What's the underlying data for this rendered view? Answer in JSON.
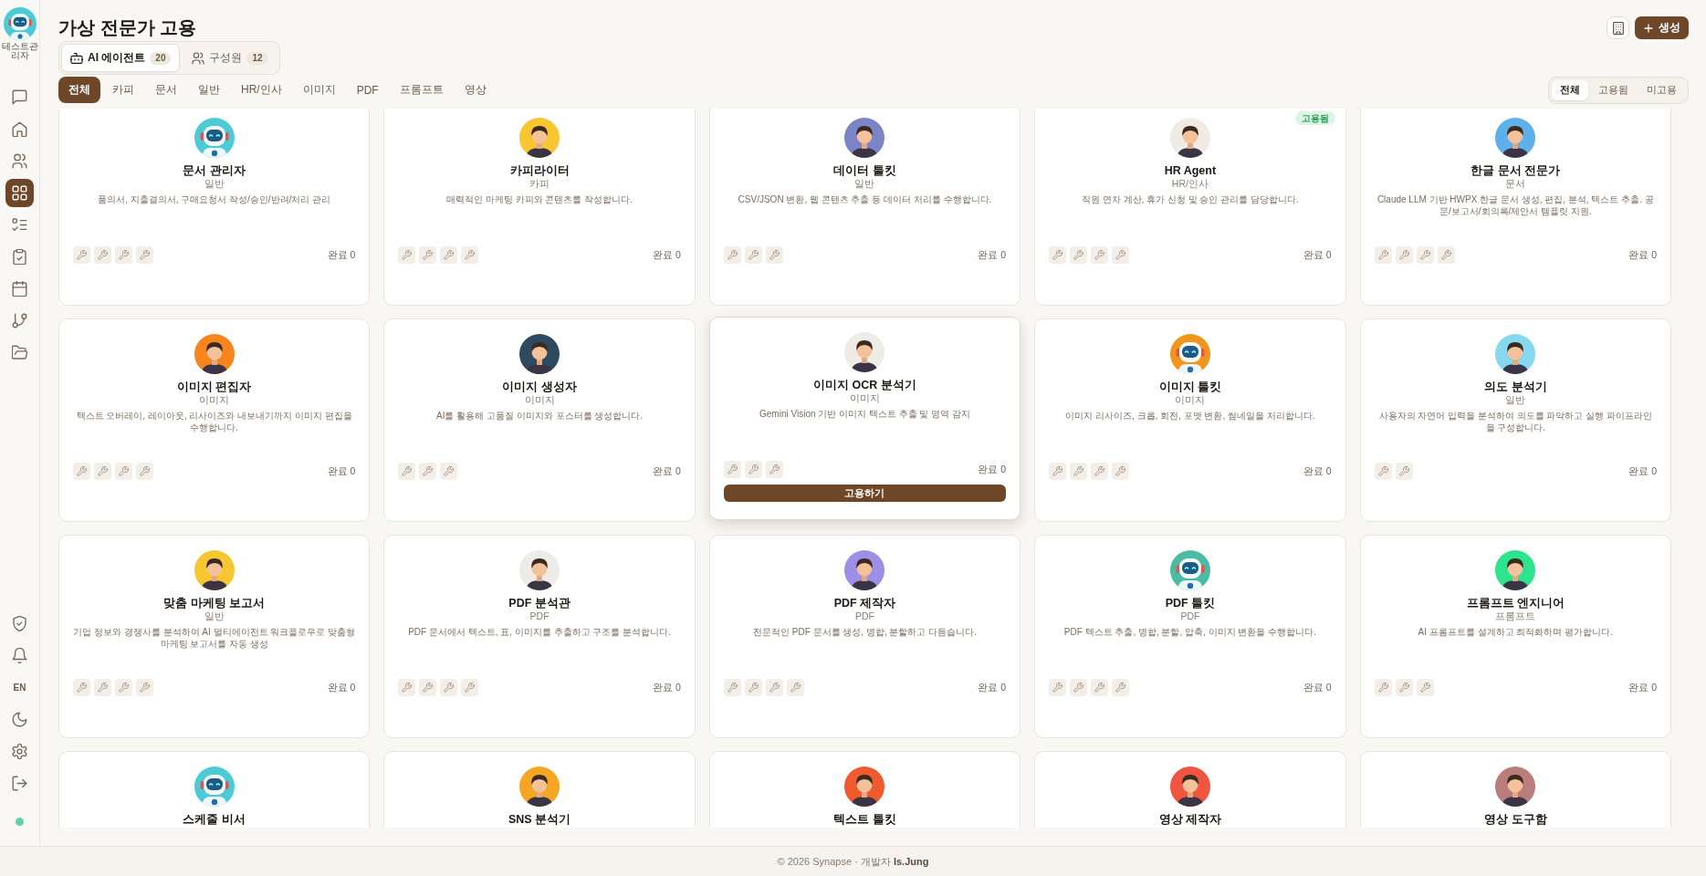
{
  "sidebar": {
    "user_name": "테스트관리자",
    "nav": [
      {
        "selected": false
      },
      {
        "selected": false
      },
      {
        "selected": false
      },
      {
        "selected": true
      },
      {
        "selected": false
      },
      {
        "selected": false
      },
      {
        "selected": false
      },
      {
        "selected": false
      },
      {
        "selected": false
      }
    ],
    "language": "EN",
    "online": true
  },
  "header": {
    "title": "가상 전문가 고용",
    "create_button": "생성"
  },
  "view_tabs": [
    {
      "label": "AI 에이전트",
      "count": "20",
      "selected": true
    },
    {
      "label": "구성원",
      "count": "12",
      "selected": false
    }
  ],
  "categories": [
    {
      "label": "전체",
      "selected": true
    },
    {
      "label": "카피",
      "selected": false
    },
    {
      "label": "문서",
      "selected": false
    },
    {
      "label": "일반",
      "selected": false
    },
    {
      "label": "HR/인사",
      "selected": false
    },
    {
      "label": "이미지",
      "selected": false
    },
    {
      "label": "PDF",
      "selected": false
    },
    {
      "label": "프롬프트",
      "selected": false
    },
    {
      "label": "영상",
      "selected": false
    }
  ],
  "status_filter": [
    {
      "label": "전체",
      "selected": true
    },
    {
      "label": "고용됨",
      "selected": false
    },
    {
      "label": "미고용",
      "selected": false
    }
  ],
  "agents": [
    {
      "name": "문서 관리자",
      "type": "일반",
      "description": "품의서, 지출결의서, 구매요청서 작성/승인/반려/처리 관리",
      "avatar": {
        "kind": "robot",
        "color": "#4ccbd6"
      },
      "tools": [
        {
          "kind": "wrench"
        },
        {
          "kind": "wrench"
        },
        {
          "kind": "wrench"
        },
        {
          "kind": "wrench"
        }
      ],
      "completed": "완료 0",
      "hovered": false
    },
    {
      "name": "카피라이터",
      "type": "카피",
      "description": "매력적인 마케팅 카피와 콘텐츠를 작성합니다.",
      "avatar": {
        "kind": "person",
        "color": "#f8c630"
      },
      "tools": [
        {
          "kind": "wrench"
        },
        {
          "kind": "wrench"
        },
        {
          "kind": "wrench"
        },
        {
          "kind": "wrench"
        }
      ],
      "completed": "완료 0",
      "hovered": false
    },
    {
      "name": "데이터 툴킷",
      "type": "일반",
      "description": "CSV/JSON 변환, 웹 콘텐츠 추출 등 데이터 처리를 수행합니다.",
      "avatar": {
        "kind": "person",
        "color": "#7b84c4"
      },
      "tools": [
        {
          "kind": "wrench"
        },
        {
          "kind": "wrench"
        },
        {
          "kind": "wrench"
        }
      ],
      "completed": "완료 0",
      "hovered": false
    },
    {
      "name": "HR Agent",
      "type": "HR/인사",
      "description": "직원 연차 계산, 휴가 신청 및 승인 관리를 담당합니다.",
      "avatar": {
        "kind": "person",
        "color": "#f1ebe5"
      },
      "tools": [
        {
          "kind": "wrench"
        },
        {
          "kind": "wrench"
        },
        {
          "kind": "wrench"
        },
        {
          "kind": "wrench"
        }
      ],
      "completed": "완료 0",
      "badge": "고용됨",
      "hovered": false
    },
    {
      "name": "한글 문서 전문가",
      "type": "문서",
      "description": "Claude LLM 기반 HWPX 한글 문서 생성, 편집, 분석, 텍스트 추출. 공문/보고서/회의록/제안서 템플릿 지원.",
      "avatar": {
        "kind": "person",
        "color": "#5db0ea"
      },
      "tools": [
        {
          "kind": "wrench"
        },
        {
          "kind": "wrench"
        },
        {
          "kind": "wrench"
        },
        {
          "kind": "wrench"
        }
      ],
      "completed": "완료 0",
      "hovered": false
    },
    {
      "name": "이미지 편집자",
      "type": "이미지",
      "description": "텍스트 오버레이, 레이아웃, 리사이즈와 내보내기까지 이미지 편집을 수행합니다.",
      "avatar": {
        "kind": "person",
        "color": "#f7851e"
      },
      "tools": [
        {
          "kind": "wrench"
        },
        {
          "kind": "wrench"
        },
        {
          "kind": "wrench"
        },
        {
          "kind": "wrench"
        }
      ],
      "completed": "완료 0",
      "hovered": false
    },
    {
      "name": "이미지 생성자",
      "type": "이미지",
      "description": "AI를 활용해 고품질 이미지와 포스터를 생성합니다.",
      "avatar": {
        "kind": "person",
        "color": "#2d4a60"
      },
      "tools": [
        {
          "kind": "wrench"
        },
        {
          "kind": "wrench"
        },
        {
          "kind": "wrench"
        }
      ],
      "completed": "완료 0",
      "hovered": false
    },
    {
      "name": "이미지 OCR 분석기",
      "type": "이미지",
      "description": "Gemini Vision 기반 이미지 텍스트 추출 및 영역 감지",
      "avatar": {
        "kind": "person",
        "color": "#efebe6"
      },
      "tools": [
        {
          "kind": "wrench"
        },
        {
          "kind": "wrench"
        },
        {
          "kind": "wrench"
        }
      ],
      "completed": "완료 0",
      "hovered": true,
      "hire_button": "고용하기"
    },
    {
      "name": "이미지 툴킷",
      "type": "이미지",
      "description": "이미지 리사이즈, 크롭, 회전, 포맷 변환, 썸네일을 처리합니다.",
      "avatar": {
        "kind": "robot",
        "color": "#f2951d"
      },
      "tools": [
        {
          "kind": "wrench"
        },
        {
          "kind": "wrench"
        },
        {
          "kind": "wrench"
        },
        {
          "kind": "wrench"
        }
      ],
      "completed": "완료 0",
      "hovered": false
    },
    {
      "name": "의도 분석기",
      "type": "일반",
      "description": "사용자의 자연어 입력을 분석하여 의도를 파악하고 실행 파이프라인을 구성합니다.",
      "avatar": {
        "kind": "person",
        "color": "#86d8ee"
      },
      "tools": [
        {
          "kind": "wrench"
        },
        {
          "kind": "wrench"
        }
      ],
      "completed": "완료 0",
      "hovered": false
    },
    {
      "name": "맞춤 마케팅 보고서",
      "type": "일반",
      "description": "기업 정보와 경쟁사를 분석하여 AI 멀티에이전트 워크플로우로 맞춤형 마케팅 보고서를 자동 생성",
      "avatar": {
        "kind": "person",
        "color": "#f8c630"
      },
      "tools": [
        {
          "kind": "wrench"
        },
        {
          "kind": "wrench"
        },
        {
          "kind": "wrench"
        },
        {
          "kind": "wrench"
        }
      ],
      "completed": "완료 0",
      "hovered": false
    },
    {
      "name": "PDF 분석관",
      "type": "PDF",
      "description": "PDF 문서에서 텍스트, 표, 이미지를 추출하고 구조를 분석합니다.",
      "avatar": {
        "kind": "person",
        "color": "#efebe6"
      },
      "tools": [
        {
          "kind": "wrench"
        },
        {
          "kind": "wrench"
        },
        {
          "kind": "wrench"
        },
        {
          "kind": "wrench"
        }
      ],
      "completed": "완료 0",
      "hovered": false
    },
    {
      "name": "PDF 제작자",
      "type": "PDF",
      "description": "전문적인 PDF 문서를 생성, 병합, 분할하고 다듬습니다.",
      "avatar": {
        "kind": "person",
        "color": "#9d8ee8"
      },
      "tools": [
        {
          "kind": "wrench"
        },
        {
          "kind": "wrench"
        },
        {
          "kind": "wrench"
        },
        {
          "kind": "wrench"
        }
      ],
      "completed": "완료 0",
      "hovered": false
    },
    {
      "name": "PDF 툴킷",
      "type": "PDF",
      "description": "PDF 텍스트 추출, 병합, 분할, 압축, 이미지 변환을 수행합니다.",
      "avatar": {
        "kind": "robot",
        "color": "#4bbba3"
      },
      "tools": [
        {
          "kind": "wrench"
        },
        {
          "kind": "wrench"
        },
        {
          "kind": "wrench"
        },
        {
          "kind": "wrench"
        }
      ],
      "completed": "완료 0",
      "hovered": false
    },
    {
      "name": "프롬프트 엔지니어",
      "type": "프롬프트",
      "description": "AI 프롬프트를 설계하고 최적화하며 평가합니다.",
      "avatar": {
        "kind": "person",
        "color": "#2de38e"
      },
      "tools": [
        {
          "kind": "wrench"
        },
        {
          "kind": "wrench"
        },
        {
          "kind": "wrench"
        }
      ],
      "completed": "완료 0",
      "hovered": false
    },
    {
      "name": "스케줄 비서",
      "avatar": {
        "kind": "robot",
        "color": "#4ccbd6"
      },
      "hovered": false
    },
    {
      "name": "SNS 분석기",
      "avatar": {
        "kind": "person",
        "color": "#f5a623"
      },
      "hovered": false
    },
    {
      "name": "텍스트 툴킷",
      "avatar": {
        "kind": "person",
        "color": "#ef5a2f"
      },
      "hovered": false
    },
    {
      "name": "영상 제작자",
      "avatar": {
        "kind": "person",
        "color": "#ef5540"
      },
      "hovered": false
    },
    {
      "name": "영상 도구함",
      "avatar": {
        "kind": "person",
        "color": "#b97d7b"
      },
      "hovered": false
    }
  ],
  "footer": {
    "credit": "© 2026 Synapse · 개발자 **Is.Jung**"
  }
}
